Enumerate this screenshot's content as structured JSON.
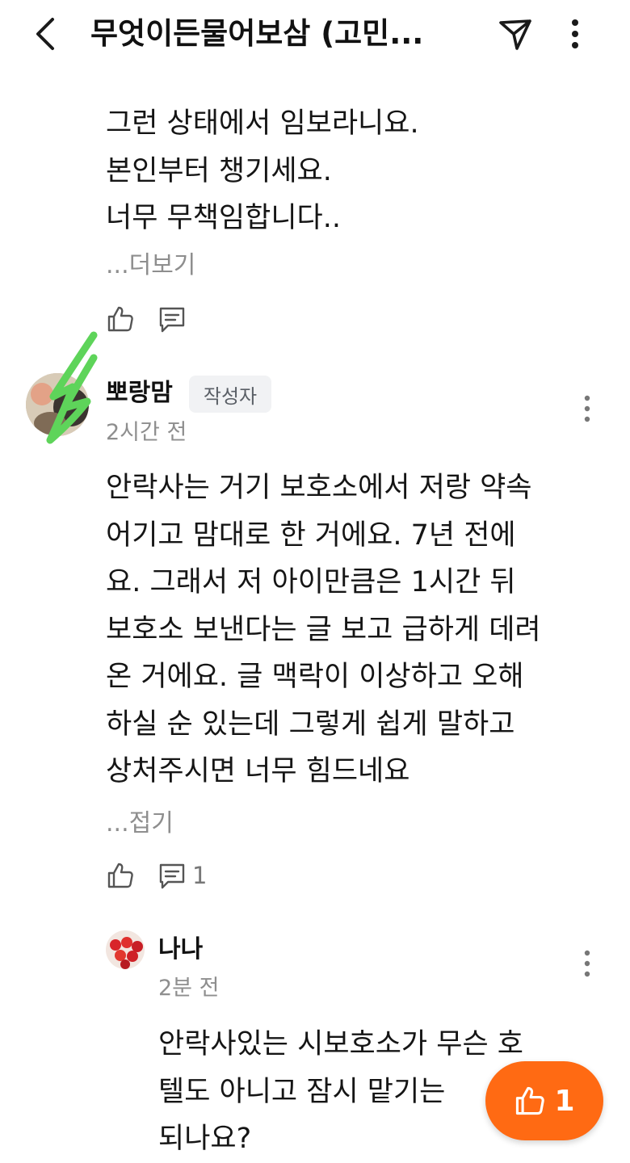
{
  "header": {
    "title": "무엇이든물어보삼 (고민..."
  },
  "prev_comment": {
    "lines": [
      "그런 상태에서 임보라니요.",
      "본인부터 챙기세요.",
      "너무 무책임합니다.."
    ],
    "more_label": "...더보기"
  },
  "main_comment": {
    "username": "뽀랑맘",
    "badge": "작성자",
    "time": "2시간 전",
    "lines": [
      "안락사는 거기 보호소에서 저랑 약속",
      "어기고 맘대로 한 거에요. 7년 전에",
      "요. 그래서 저 아이만큼은 1시간 뒤",
      "보호소 보낸다는 글 보고 급하게 데려",
      "온 거에요. 글 맥락이 이상하고 오해",
      "하실 순 있는데 그렇게 쉽게 말하고",
      "상처주시면 너무 힘드네요"
    ],
    "collapse_label": "...접기",
    "reply_count": "1"
  },
  "reply": {
    "username": "나나",
    "time": "2분 전",
    "lines": [
      "안락사있는 시보호소가 무슨 호",
      "텔도 아니고 잠시 맡기는",
      "되나요?"
    ]
  },
  "fab": {
    "count": "1"
  },
  "colors": {
    "fab": "#ff6a13",
    "annotation_green": "#5ed45a"
  }
}
